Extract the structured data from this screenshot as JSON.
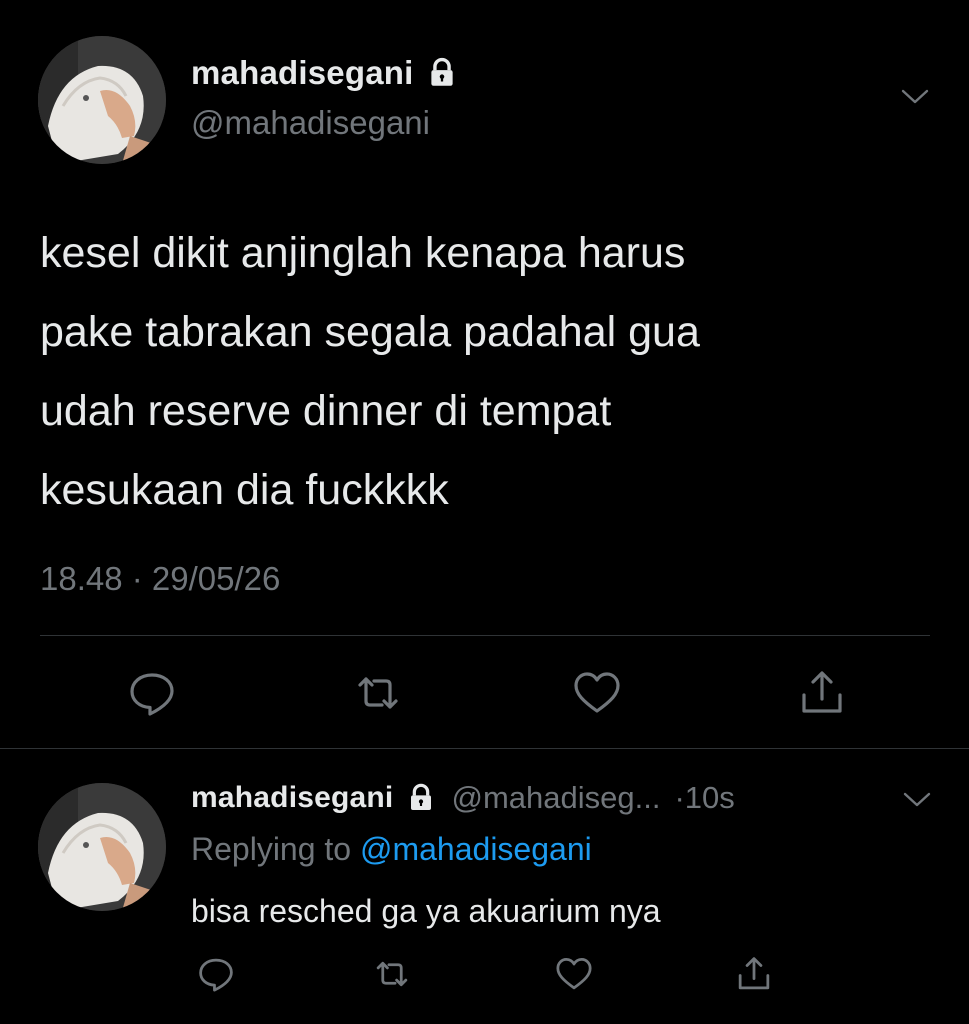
{
  "main_tweet": {
    "display_name": "mahadisegani",
    "handle": "@mahadisegani",
    "locked_icon": "lock-icon",
    "text_lines": [
      "kesel dikit anjinglah kenapa harus",
      "pake tabrakan segala padahal gua",
      "udah reserve dinner di tempat",
      "kesukaan dia fuckkkk"
    ],
    "timestamp": "18.48 · 29/05/26",
    "actions": [
      "reply-icon",
      "retweet-icon",
      "like-icon",
      "share-icon"
    ]
  },
  "reply_tweet": {
    "display_name": "mahadisegani",
    "handle": "@mahadiseg...",
    "time": "·10s",
    "replying_prefix": "Replying to",
    "replying_mention": "@mahadisegani",
    "text": "bisa resched ga ya akuarium nya",
    "actions": [
      "reply-icon",
      "retweet-icon",
      "like-icon",
      "share-icon"
    ]
  },
  "colors": {
    "background": "#000000",
    "text_primary": "#e7e9ea",
    "text_secondary": "#71767b",
    "link": "#1d9bf0",
    "divider": "#2f3336"
  }
}
